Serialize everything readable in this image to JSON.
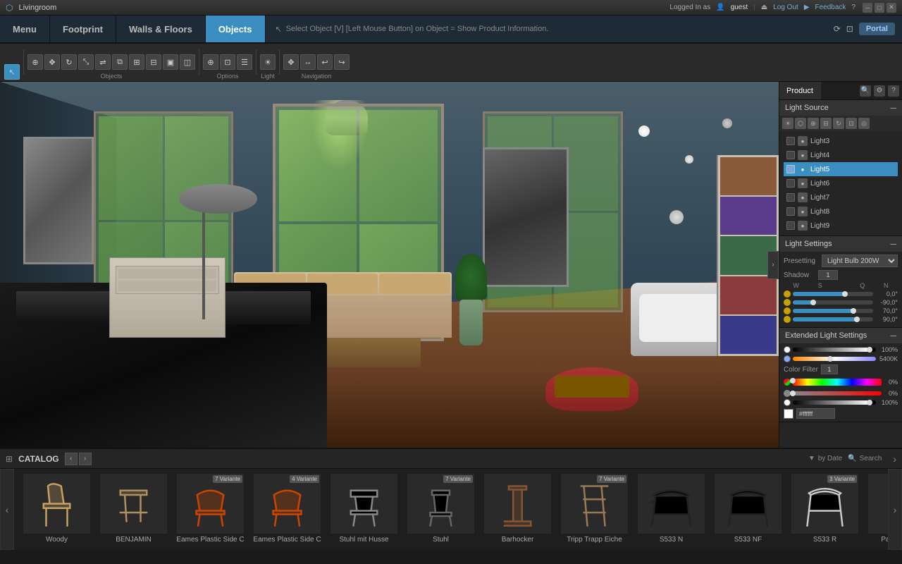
{
  "titlebar": {
    "icon": "●",
    "title": "Livingroom",
    "win_buttons": [
      "─",
      "□",
      "✕"
    ]
  },
  "loginbar": {
    "logged_in_as": "Logged In as",
    "user": "guest",
    "logout": "Log Out",
    "feedback": "Feedback",
    "help": "?",
    "portal": "Portal"
  },
  "navbar": {
    "items": [
      {
        "id": "menu",
        "label": "Menu",
        "active": false
      },
      {
        "id": "footprint",
        "label": "Footprint",
        "active": false
      },
      {
        "id": "walls-floors",
        "label": "Walls & Floors",
        "active": false
      },
      {
        "id": "objects",
        "label": "Objects",
        "active": true
      }
    ],
    "hint": "Select Object [V]  [Left Mouse Button] on Object = Show Product Information."
  },
  "toolbar": {
    "groups": [
      {
        "id": "objects",
        "label": "Objects",
        "buttons": [
          "↖",
          "⊕",
          "●",
          "◉",
          "◎",
          "⬟",
          "▲",
          "⬡",
          "⊞",
          "⊟",
          "▣",
          "◫"
        ]
      },
      {
        "id": "options",
        "label": "Options",
        "buttons": [
          "⊕",
          "⊡",
          "☰"
        ]
      },
      {
        "id": "light",
        "label": "Light",
        "buttons": [
          "☀"
        ]
      },
      {
        "id": "navigation",
        "label": "Navigation",
        "buttons": [
          "✥",
          "↔",
          "↩",
          "↪"
        ]
      }
    ]
  },
  "rightpanel": {
    "tabs": [
      {
        "id": "product",
        "label": "Product",
        "active": true
      }
    ],
    "light_source": {
      "title": "Light Source",
      "lights": [
        {
          "id": "light3",
          "label": "Light3",
          "active": false
        },
        {
          "id": "light4",
          "label": "Light4",
          "active": false
        },
        {
          "id": "light5",
          "label": "Light5",
          "active": true
        },
        {
          "id": "light6",
          "label": "Light6",
          "active": false
        },
        {
          "id": "light7",
          "label": "Light7",
          "active": false
        },
        {
          "id": "light8",
          "label": "Light8",
          "active": false
        },
        {
          "id": "light9",
          "label": "Light9",
          "active": false
        }
      ]
    },
    "light_settings": {
      "title": "Light Settings",
      "presetting_label": "Presetting",
      "presetting_value": "Light Bulb 200W",
      "shadow_label": "Shadow",
      "shadow_value": "1",
      "sliders": [
        {
          "id": "w",
          "label": "W",
          "value": "0,0°",
          "fill_pct": 65
        },
        {
          "id": "s",
          "label": "S",
          "value": "-90,0°",
          "fill_pct": 25
        },
        {
          "id": "n",
          "label": "N",
          "value": "70,0°",
          "fill_pct": 75
        },
        {
          "id": "q",
          "label": "Q",
          "value": "90,0°",
          "fill_pct": 80
        }
      ]
    },
    "extended_light": {
      "title": "Extended Light Settings",
      "brightness_pct": "100%",
      "brightness_fill": 92,
      "temp_value": "5400K",
      "temp_fill": 45,
      "color_filter_label": "Color Filter",
      "color_filter_value": "1",
      "hue_pct": "0%",
      "hue_fill": 0,
      "saturation_pct": "0%",
      "saturation_fill": 0,
      "lightness_pct": "100%",
      "lightness_fill": 92,
      "hex_value": "#ffffff"
    }
  },
  "catalog": {
    "label": "CATALOG",
    "sort_label": "by Date",
    "search_label": "Search",
    "items": [
      {
        "id": "woody",
        "name": "Woody",
        "variants": null,
        "color": "#c8a060"
      },
      {
        "id": "benjamin",
        "name": "BENJAMIN",
        "variants": null,
        "color": "#b09060"
      },
      {
        "id": "eames1",
        "name": "Eames Plastic Side C",
        "variants": 7,
        "color": "#cc4400"
      },
      {
        "id": "eames2",
        "name": "Eames Plastic Side C",
        "variants": 4,
        "color": "#cc4400"
      },
      {
        "id": "stuhl-husse",
        "name": "Stuhl mit Husse",
        "variants": null,
        "color": "#888"
      },
      {
        "id": "stuhl",
        "name": "Stuhl",
        "variants": 7,
        "color": "#666"
      },
      {
        "id": "barhocker",
        "name": "Barhocker",
        "variants": null,
        "color": "#885533"
      },
      {
        "id": "tripp-trapp",
        "name": "Tripp Trapp Eiche",
        "variants": 7,
        "color": "#9a7a55"
      },
      {
        "id": "s533n",
        "name": "S533 N",
        "variants": null,
        "color": "#222"
      },
      {
        "id": "s533nf",
        "name": "S533 NF",
        "variants": null,
        "color": "#222"
      },
      {
        "id": "s533r",
        "name": "S533 R",
        "variants": 3,
        "color": "#ccc"
      },
      {
        "id": "panton",
        "name": "Panton Chair",
        "variants": null,
        "color": "#ddd"
      }
    ]
  }
}
